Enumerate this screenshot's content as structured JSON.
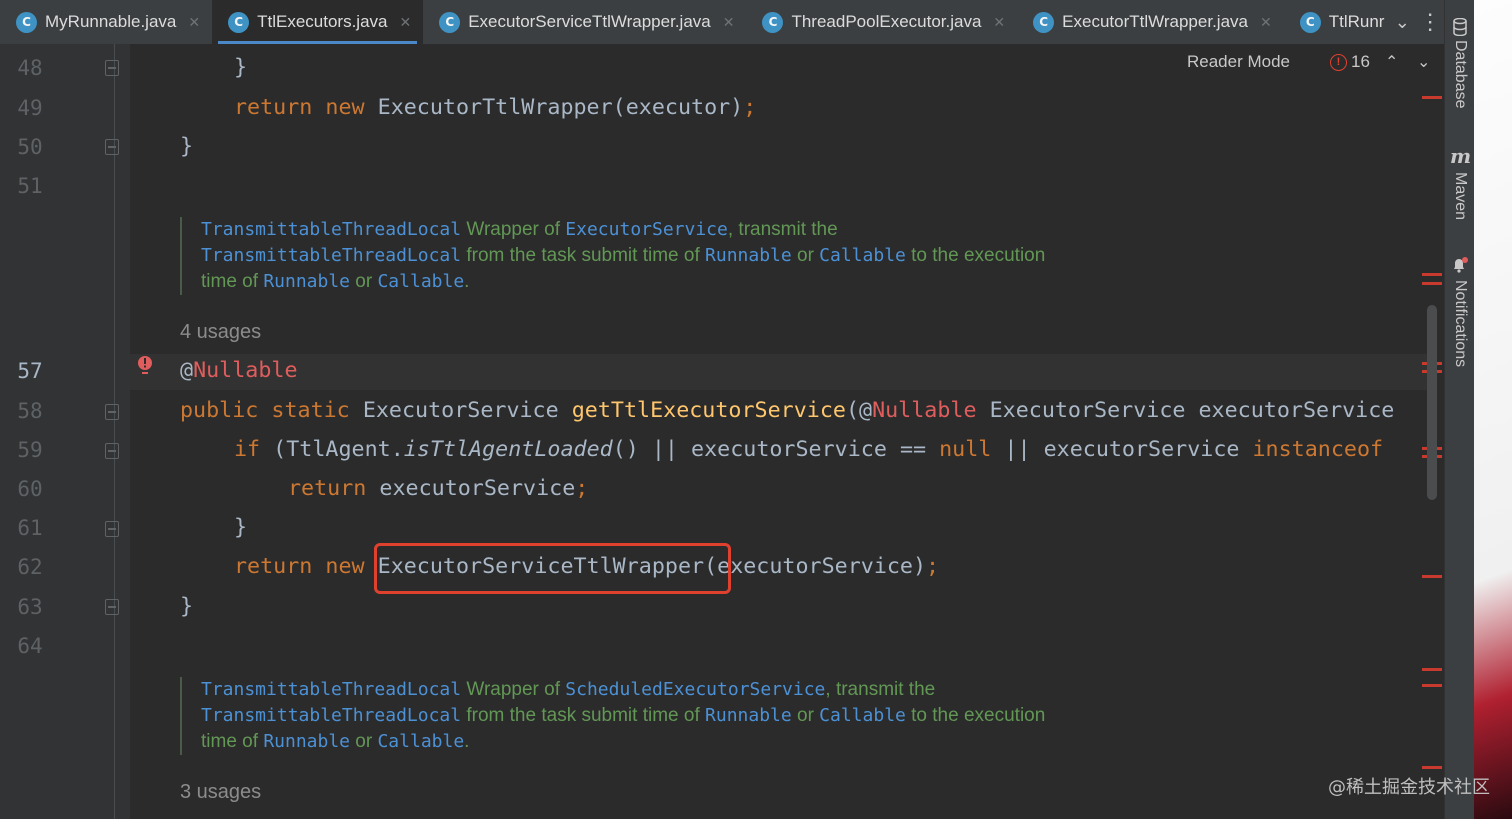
{
  "tabs": [
    {
      "label": "MyRunnable.java",
      "active": false,
      "closable": true
    },
    {
      "label": "TtlExecutors.java",
      "active": true,
      "closable": true
    },
    {
      "label": "ExecutorServiceTtlWrapper.java",
      "active": false,
      "closable": true
    },
    {
      "label": "ThreadPoolExecutor.java",
      "active": false,
      "closable": true
    },
    {
      "label": "ExecutorTtlWrapper.java",
      "active": false,
      "closable": true
    },
    {
      "label": "TtlRunr",
      "active": false,
      "closable": false
    }
  ],
  "toolbar": {
    "reader_mode": "Reader Mode",
    "problem_count": "16"
  },
  "sidebar": {
    "database": "Database",
    "maven": "Maven",
    "notifications": "Notifications"
  },
  "line_numbers": [
    "48",
    "49",
    "50",
    "51",
    "57",
    "58",
    "59",
    "60",
    "61",
    "62",
    "63",
    "64"
  ],
  "code": {
    "l48": "}",
    "l49_kw": "return new ",
    "l49_rest": "ExecutorTtlWrapper(executor)",
    "l50": "}",
    "l57_at": "@",
    "l57_ann": "Nullable",
    "l58_kw": "public static ",
    "l58_type": "ExecutorService ",
    "l58_fn": "getTtlExecutorService",
    "l58_paren": "(@",
    "l58_ann": "Nullable",
    "l58_rest": " ExecutorService executorService",
    "l59_kw": "if",
    "l59_a": " (TtlAgent.",
    "l59_it": "isTtlAgentLoaded",
    "l59_b": "() || executorService == ",
    "l59_null": "null",
    "l59_c": " || executorService ",
    "l59_inst": "instanceof",
    "l60_kw": "return ",
    "l60_rest": "executorService",
    "l61": "}",
    "l62_kw": "return new ",
    "l62_cls": "ExecutorServiceTtlWrapper",
    "l62_rest": "(executorService)",
    "l63": "}"
  },
  "doc1": {
    "r1": "TransmittableThreadLocal",
    "t1": " Wrapper of ",
    "r2": "ExecutorService",
    "t2": ", transmit the",
    "r3": "TransmittableThreadLocal",
    "t3": " from the task submit time of ",
    "r4": "Runnable",
    "t4": " or ",
    "r5": "Callable",
    "t5": " to the execution",
    "t6": "time of ",
    "r6": "Runnable",
    "t7": " or ",
    "r7": "Callable",
    "t8": "."
  },
  "doc2": {
    "r1": "TransmittableThreadLocal",
    "t1": " Wrapper of ",
    "r2": "ScheduledExecutorService",
    "t2": ", transmit the",
    "r3": "TransmittableThreadLocal",
    "t3": " from the task submit time of ",
    "r4": "Runnable",
    "t4": " or ",
    "r5": "Callable",
    "t5": " to the execution",
    "t6": "time of ",
    "r6": "Runnable",
    "t7": " or ",
    "r7": "Callable",
    "t8": "."
  },
  "usages1": "4 usages",
  "usages2": "3 usages",
  "watermark": "@稀土掘金技术社区",
  "colors": {
    "accent": "#4a88c7",
    "highlight": "#e0412f",
    "keyword": "#cc7832",
    "annotation": "#bbb529"
  }
}
